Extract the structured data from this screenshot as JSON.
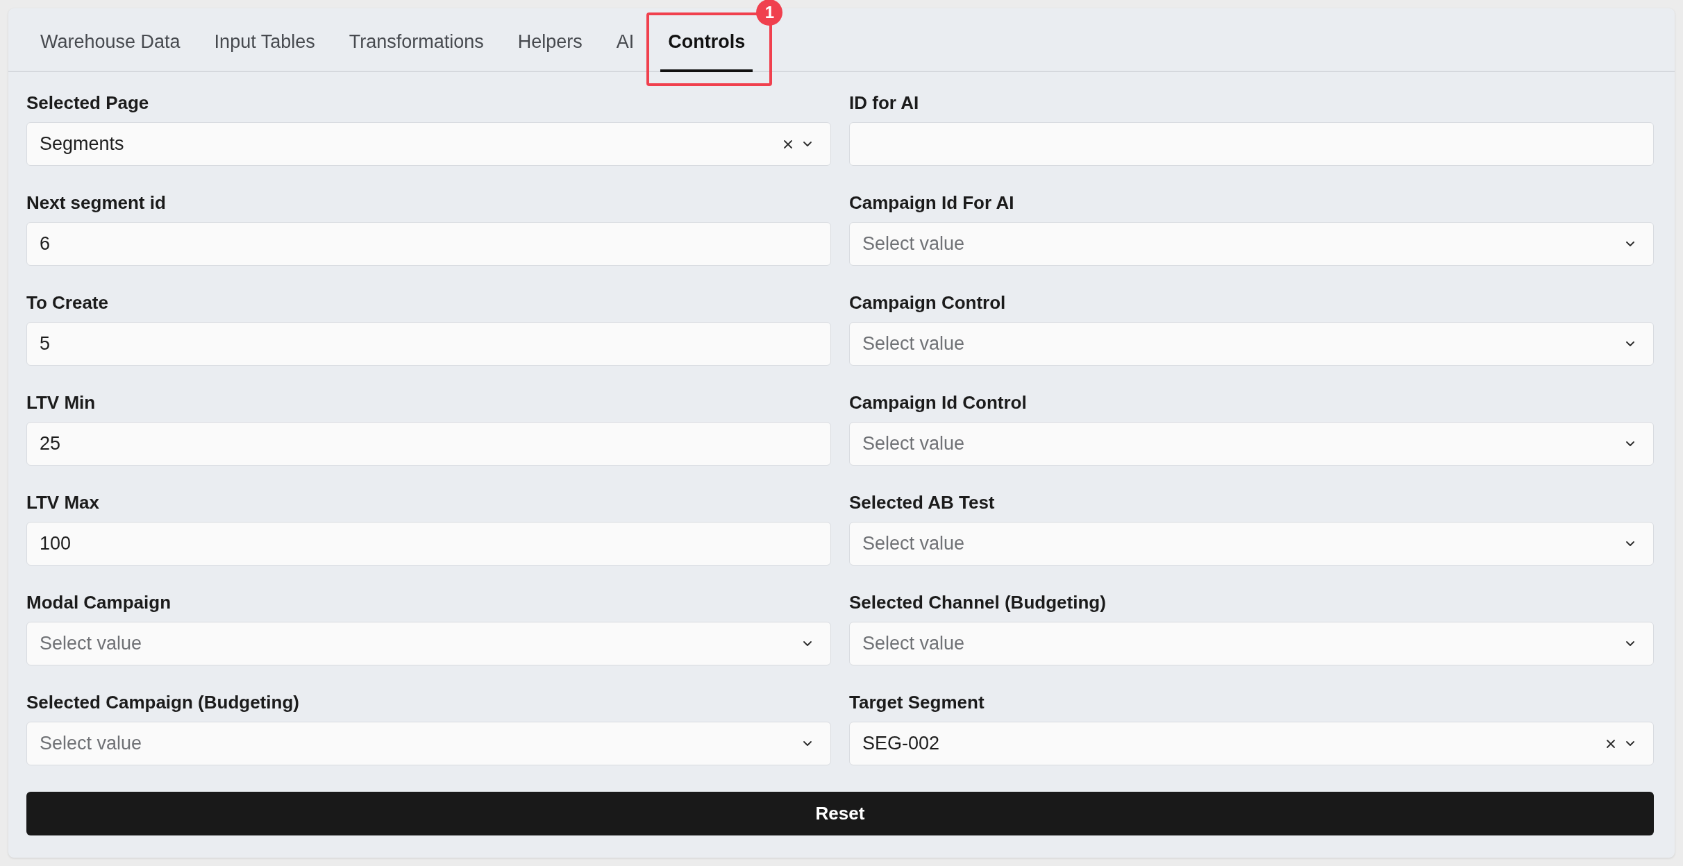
{
  "tabs": [
    {
      "label": "Warehouse Data",
      "selected": false
    },
    {
      "label": "Input Tables",
      "selected": false
    },
    {
      "label": "Transformations",
      "selected": false
    },
    {
      "label": "Helpers",
      "selected": false
    },
    {
      "label": "AI",
      "selected": false
    },
    {
      "label": "Controls",
      "selected": true,
      "annotation": "1"
    }
  ],
  "columns": [
    {
      "fields": [
        {
          "label": "Selected Page",
          "kind": "select",
          "value": "Segments"
        },
        {
          "label": "Next segment id",
          "kind": "text",
          "value": "6"
        },
        {
          "label": "To Create",
          "kind": "text",
          "value": "5"
        },
        {
          "label": "LTV Min",
          "kind": "text",
          "value": "25"
        },
        {
          "label": "LTV Max",
          "kind": "text",
          "value": "100"
        },
        {
          "label": "Modal Campaign",
          "kind": "select",
          "placeholder": "Select value"
        },
        {
          "label": "Selected Campaign (Budgeting)",
          "kind": "select",
          "placeholder": "Select value"
        }
      ]
    },
    {
      "fields": [
        {
          "label": "ID for AI",
          "kind": "text"
        },
        {
          "label": "Campaign Id For AI",
          "kind": "select",
          "placeholder": "Select value"
        },
        {
          "label": "Campaign Control",
          "kind": "select",
          "placeholder": "Select value"
        },
        {
          "label": "Campaign Id Control",
          "kind": "select",
          "placeholder": "Select value"
        },
        {
          "label": "Selected AB Test",
          "kind": "select",
          "placeholder": "Select value"
        },
        {
          "label": "Selected Channel (Budgeting)",
          "kind": "select",
          "placeholder": "Select value"
        },
        {
          "label": "Target Segment",
          "kind": "select",
          "value": "SEG-002"
        }
      ]
    }
  ],
  "reset_button": {
    "label": "Reset"
  }
}
